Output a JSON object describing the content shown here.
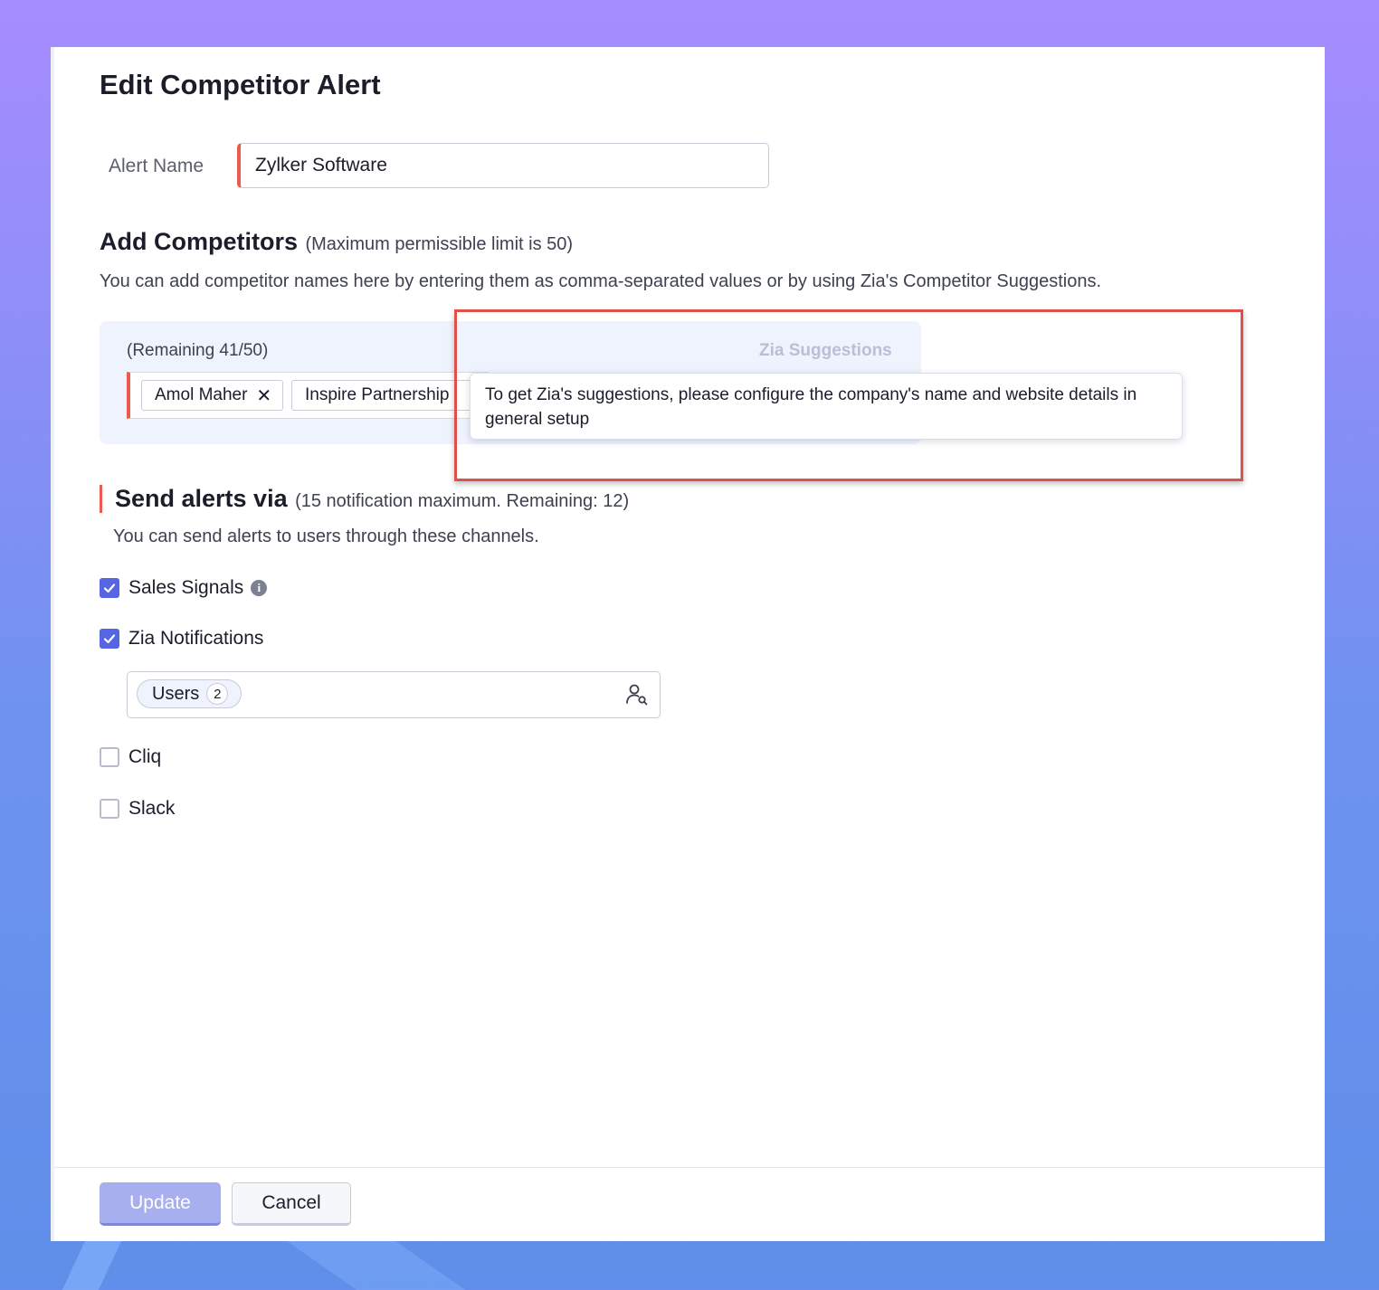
{
  "page": {
    "title": "Edit Competitor Alert"
  },
  "alert_name": {
    "label": "Alert Name",
    "value": "Zylker Software"
  },
  "competitors": {
    "heading": "Add Competitors",
    "limit_note": "(Maximum permissible limit is 50)",
    "description": "You can add competitor names here by entering them as comma-separated values or by using Zia's Competitor Suggestions.",
    "remaining": "(Remaining 41/50)",
    "suggestions_label": "Zia Suggestions",
    "tags": [
      {
        "label": "Amol Maher"
      },
      {
        "label": "Inspire Partnership"
      }
    ],
    "tooltip": "To get Zia's suggestions, please configure the company's name and website details in general setup"
  },
  "send_alerts": {
    "heading": "Send alerts via",
    "note": "(15 notification maximum. Remaining: 12)",
    "description": "You can send alerts to users through these channels.",
    "channels": [
      {
        "label": "Sales Signals",
        "checked": true
      },
      {
        "label": "Zia Notifications",
        "checked": true
      },
      {
        "label": "Cliq",
        "checked": false
      },
      {
        "label": "Slack",
        "checked": false
      }
    ],
    "users_chip": {
      "label": "Users",
      "count": "2"
    }
  },
  "footer": {
    "update_label": "Update",
    "cancel_label": "Cancel"
  },
  "colors": {
    "accent": "#5666e2",
    "required_marker": "#ea5b4d",
    "highlight_box": "#e0504a"
  }
}
